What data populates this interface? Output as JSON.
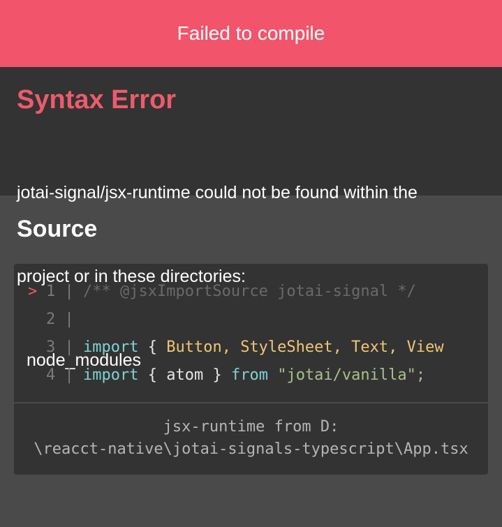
{
  "header": {
    "title": "Failed to compile"
  },
  "error": {
    "title": "Syntax Error",
    "message_line1": "jotai-signal/jsx-runtime could not be found within the",
    "message_line2": "project or in these directories:",
    "message_line3": "node_modules"
  },
  "source": {
    "title": "Source",
    "lines": [
      {
        "marker": ">",
        "num": "1",
        "comment": "/** @jsxImportSource jotai-signal */"
      },
      {
        "marker": "",
        "num": "2"
      },
      {
        "marker": "",
        "num": "3",
        "kw": "import",
        "open": "{",
        "names": "Button, StyleSheet, Text, View"
      },
      {
        "marker": "",
        "num": "4",
        "kw": "import",
        "open": "{",
        "ident": "atom",
        "close": "}",
        "from": "from",
        "str": "\"jotai/vanilla\";"
      }
    ],
    "footer_line1": "jsx-runtime from D:",
    "footer_line2": "\\reacct-native\\jotai-signals-typescript\\App.tsx"
  },
  "colors": {
    "header_bg": "#f2546b",
    "error_title": "#ee5b6b",
    "panel_dark": "#333333",
    "panel_mid": "#4a4a4a"
  }
}
